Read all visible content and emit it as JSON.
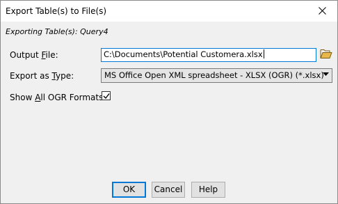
{
  "window": {
    "title": "Export Table(s) to File(s)"
  },
  "subtitle": "Exporting Table(s): Query4",
  "form": {
    "output_file": {
      "label_pre": "Output ",
      "label_underlined": "F",
      "label_post": "ile:",
      "value": "C:\\Documents\\Potential Customera.xlsx"
    },
    "export_type": {
      "label_pre": "Export as ",
      "label_underlined": "T",
      "label_post": "ype:",
      "selected": "MS Office Open XML spreadsheet - XLSX (OGR) (*.xlsx)"
    },
    "show_all": {
      "label_pre": "Show ",
      "label_underlined": "A",
      "label_post": "ll OGR Formats:",
      "checked": true
    }
  },
  "buttons": {
    "ok": "OK",
    "cancel": "Cancel",
    "help": "Help"
  },
  "colors": {
    "accent": "#0078d7",
    "dialog_bg": "#f0f0f0",
    "folder": "#e8b84a"
  },
  "icons": {
    "close": "close-icon",
    "folder": "open-folder-icon",
    "dropdown": "chevron-down-icon",
    "check": "checkmark-icon"
  }
}
